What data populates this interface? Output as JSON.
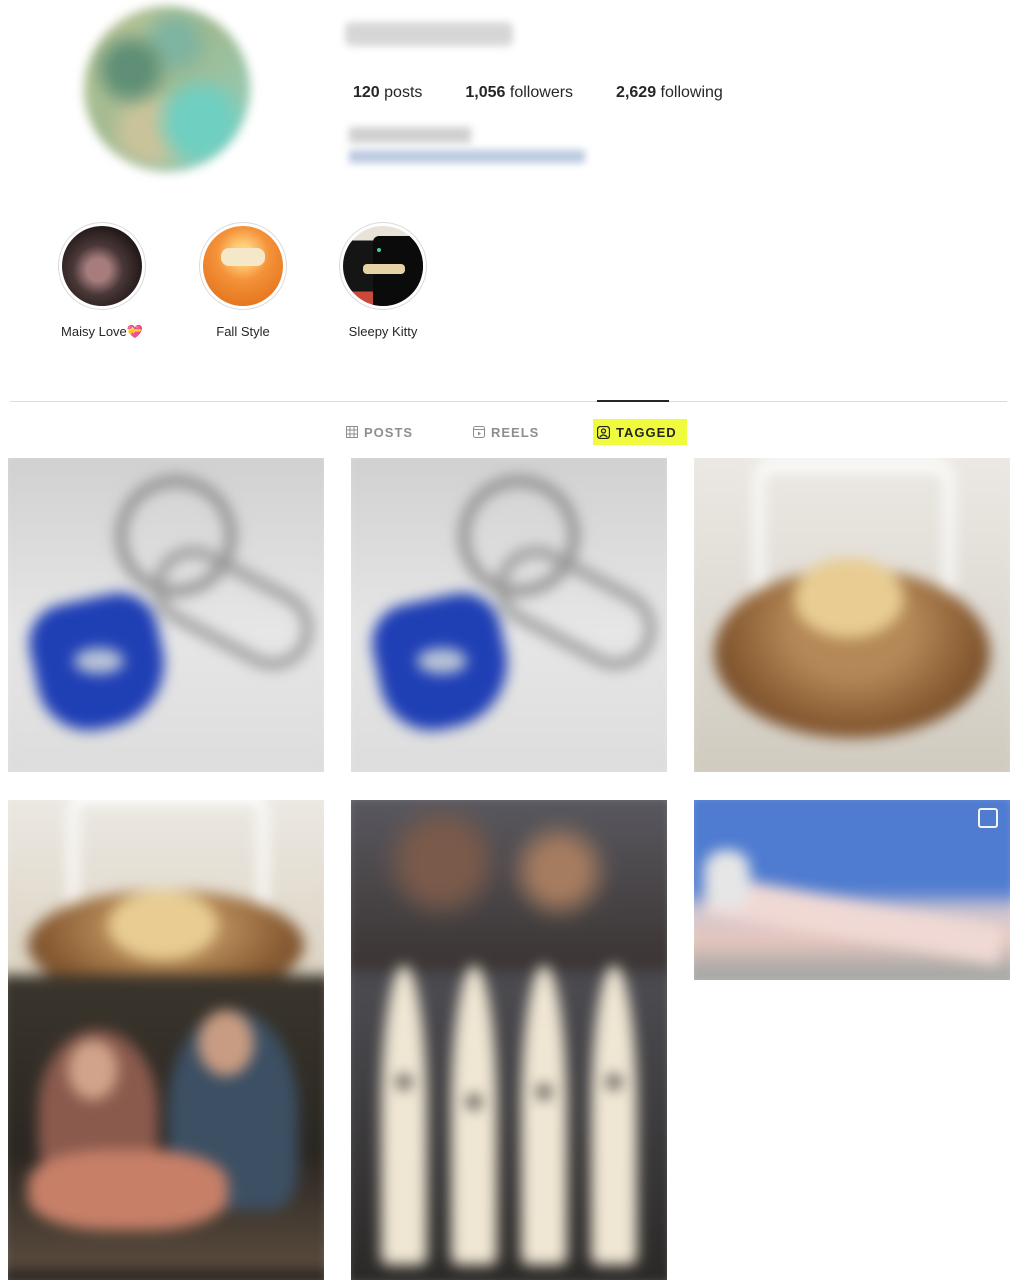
{
  "profile": {
    "username": "",
    "bio_name": "",
    "bio_link": "",
    "stats": [
      {
        "count": "120",
        "label": "posts"
      },
      {
        "count": "1,056",
        "label": "followers"
      },
      {
        "count": "2,629",
        "label": "following"
      }
    ]
  },
  "highlights": [
    {
      "label": "Maisy Love",
      "emoji": "💝"
    },
    {
      "label": "Fall Style",
      "emoji": ""
    },
    {
      "label": "Sleepy Kitty",
      "emoji": ""
    }
  ],
  "tabs": [
    {
      "label": "POSTS",
      "icon": "grid-icon",
      "active": false
    },
    {
      "label": "REELS",
      "icon": "reels-icon",
      "active": false
    },
    {
      "label": "TAGGED",
      "icon": "tagged-icon",
      "active": true
    }
  ],
  "colors": {
    "highlight_marker": "#f1fb3d",
    "text": "#262626",
    "muted": "#8e8e8e",
    "divider": "#dbdbdb"
  },
  "grid": [
    {
      "subject": "keychain-blue-tag"
    },
    {
      "subject": "keychain-blue-tag"
    },
    {
      "subject": "egg-in-nest-jar"
    },
    {
      "subject": "egg-in-nest-and-couple"
    },
    {
      "subject": "crowd-and-skis"
    },
    {
      "subject": "sky-slide"
    }
  ]
}
